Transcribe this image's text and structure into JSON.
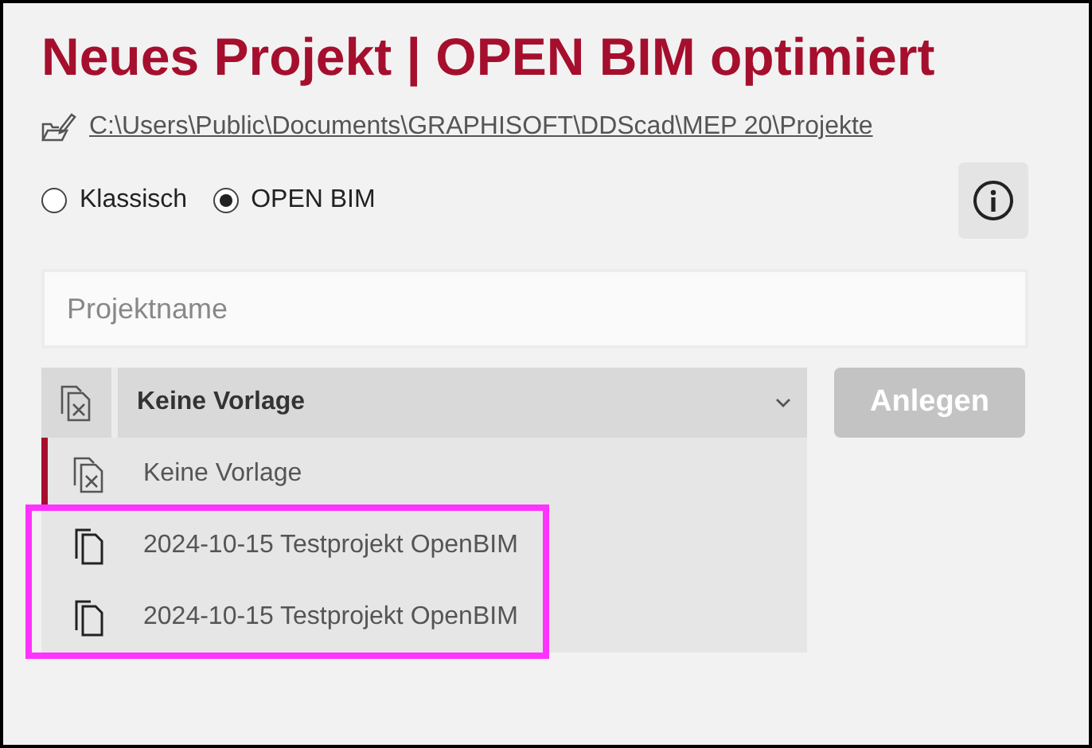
{
  "title": "Neues Projekt | OPEN BIM optimiert",
  "path": "C:\\Users\\Public\\Documents\\GRAPHISOFT\\DDScad\\MEP 20\\Projekte",
  "mode_options": [
    {
      "label": "Klassisch",
      "selected": false
    },
    {
      "label": "OPEN BIM",
      "selected": true
    }
  ],
  "project_name": {
    "placeholder": "Projektname"
  },
  "template_select": {
    "value": "Keine Vorlage",
    "kind": "none",
    "expanded": true,
    "items": [
      {
        "label": "Keine Vorlage",
        "kind": "none",
        "selected": true,
        "highlighted": false
      },
      {
        "label": "2024-10-15 Testprojekt OpenBIM",
        "kind": "file",
        "selected": false,
        "highlighted": true
      },
      {
        "label": "2024-10-15 Testprojekt OpenBIM",
        "kind": "file",
        "selected": false,
        "highlighted": true
      }
    ]
  },
  "create_button": {
    "label": "Anlegen",
    "disabled": true
  }
}
